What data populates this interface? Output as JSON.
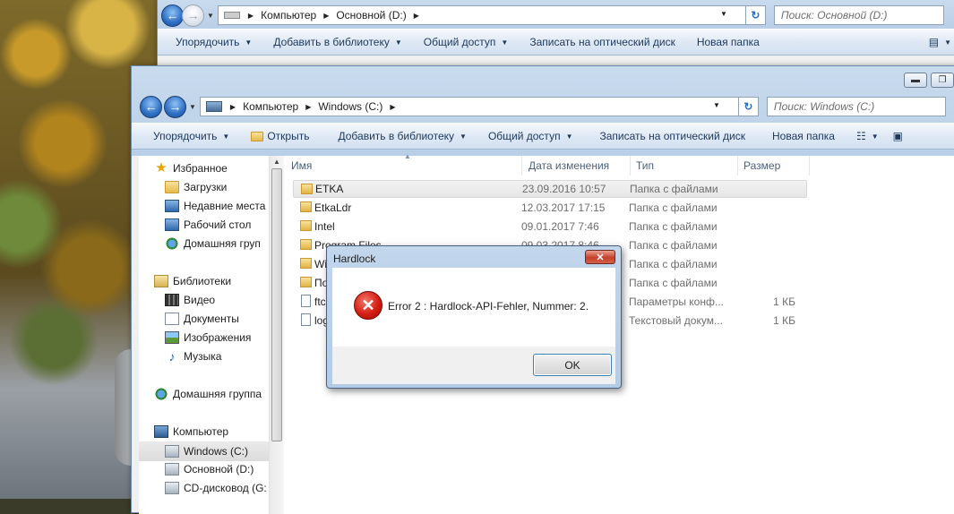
{
  "background_window": {
    "breadcrumb": [
      "Компьютер",
      "Основной (D:)"
    ],
    "search_placeholder": "Поиск: Основной (D:)",
    "toolbar": [
      "Упорядочить",
      "Добавить в библиотеку",
      "Общий доступ",
      "Записать на оптический диск",
      "Новая папка"
    ]
  },
  "main_window": {
    "breadcrumb": [
      "Компьютер",
      "Windows (C:)"
    ],
    "search_placeholder": "Поиск: Windows (C:)",
    "toolbar": {
      "organize": "Упорядочить",
      "open": "Открыть",
      "add_to_library": "Добавить в библиотеку",
      "share": "Общий доступ",
      "burn": "Записать на оптический диск",
      "new_folder": "Новая папка"
    },
    "nav": {
      "favorites": "Избранное",
      "downloads": "Загрузки",
      "recent": "Недавние места",
      "desktop": "Рабочий стол",
      "homegroup_short": "Домашняя груп",
      "libraries": "Библиотеки",
      "video": "Видео",
      "documents": "Документы",
      "images": "Изображения",
      "music": "Музыка",
      "homegroup": "Домашняя группа",
      "computer": "Компьютер",
      "drive_c": "Windows (C:)",
      "drive_d": "Основной (D:)",
      "drive_cd": "CD-дисковод (G:"
    },
    "columns": {
      "name": "Имя",
      "date": "Дата изменения",
      "type": "Тип",
      "size": "Размер"
    },
    "files": [
      {
        "name": "ETKA",
        "date": "23.09.2016 10:57",
        "type": "Папка с файлами",
        "size": ""
      },
      {
        "name": "EtkaLdr",
        "date": "12.03.2017 17:15",
        "type": "Папка с файлами",
        "size": ""
      },
      {
        "name": "Intel",
        "date": "09.01.2017 7:46",
        "type": "Папка с файлами",
        "size": ""
      },
      {
        "name": "Program Files",
        "date": "09.03.2017 8:46",
        "type": "Папка с файлами",
        "size": ""
      },
      {
        "name": "Wi",
        "date": "",
        "type": "Папка с файлами",
        "size": ""
      },
      {
        "name": "По",
        "date": "",
        "type": "Папка с файлами",
        "size": ""
      },
      {
        "name": "ftc",
        "date": "",
        "type": "Параметры конф...",
        "size": "1 КБ"
      },
      {
        "name": "log",
        "date": "",
        "type": "Текстовый докум...",
        "size": "1 КБ"
      }
    ]
  },
  "dialog": {
    "title": "Hardlock",
    "message": "Error 2 : Hardlock-API-Fehler, Nummer: 2.",
    "ok": "OK",
    "close": "✕"
  }
}
